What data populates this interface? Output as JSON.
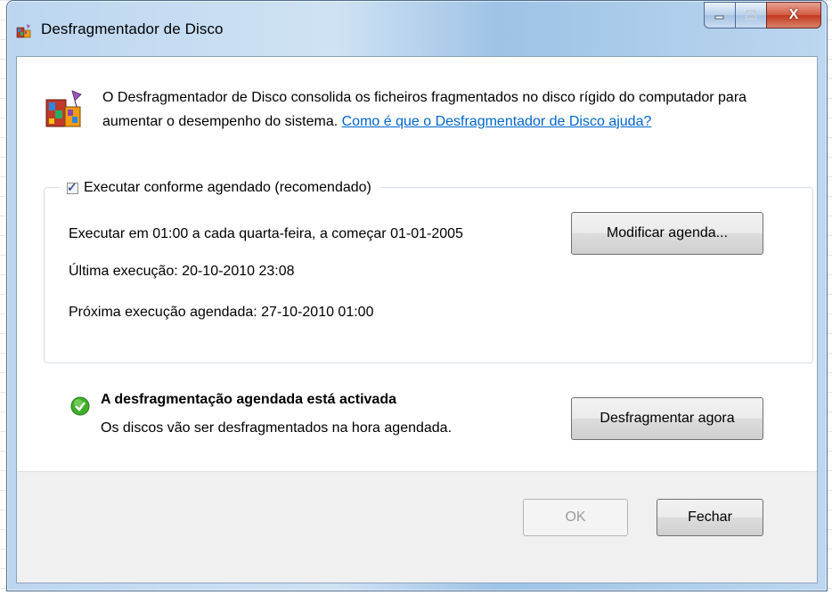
{
  "window": {
    "title": "Desfragmentador de Disco",
    "close_glyph": "X"
  },
  "intro": {
    "text": "O Desfragmentador de Disco consolida os ficheiros fragmentados no disco rígido do computador para aumentar o desempenho do sistema. ",
    "help_link": "Como é que o Desfragmentador de Disco ajuda?"
  },
  "schedule": {
    "checkbox_label": "Executar conforme agendado (recomendado)",
    "checked": true,
    "run_line": "Executar em 01:00 a cada quarta-feira, a começar 01-01-2005",
    "last_run": "Última execução: 20-10-2010 23:08",
    "next_run": "Próxima execução agendada: 27-10-2010 01:00",
    "modify_button": "Modificar agenda..."
  },
  "status": {
    "title": "A desfragmentação agendada está activada",
    "subtitle": "Os discos vão ser desfragmentados na hora agendada.",
    "defrag_button": "Desfragmentar agora",
    "icon": "green-check-icon"
  },
  "footer": {
    "ok_button": "OK",
    "close_button": "Fechar"
  },
  "icons": {
    "app": "defrag-app-icon",
    "intro": "defrag-large-icon"
  }
}
